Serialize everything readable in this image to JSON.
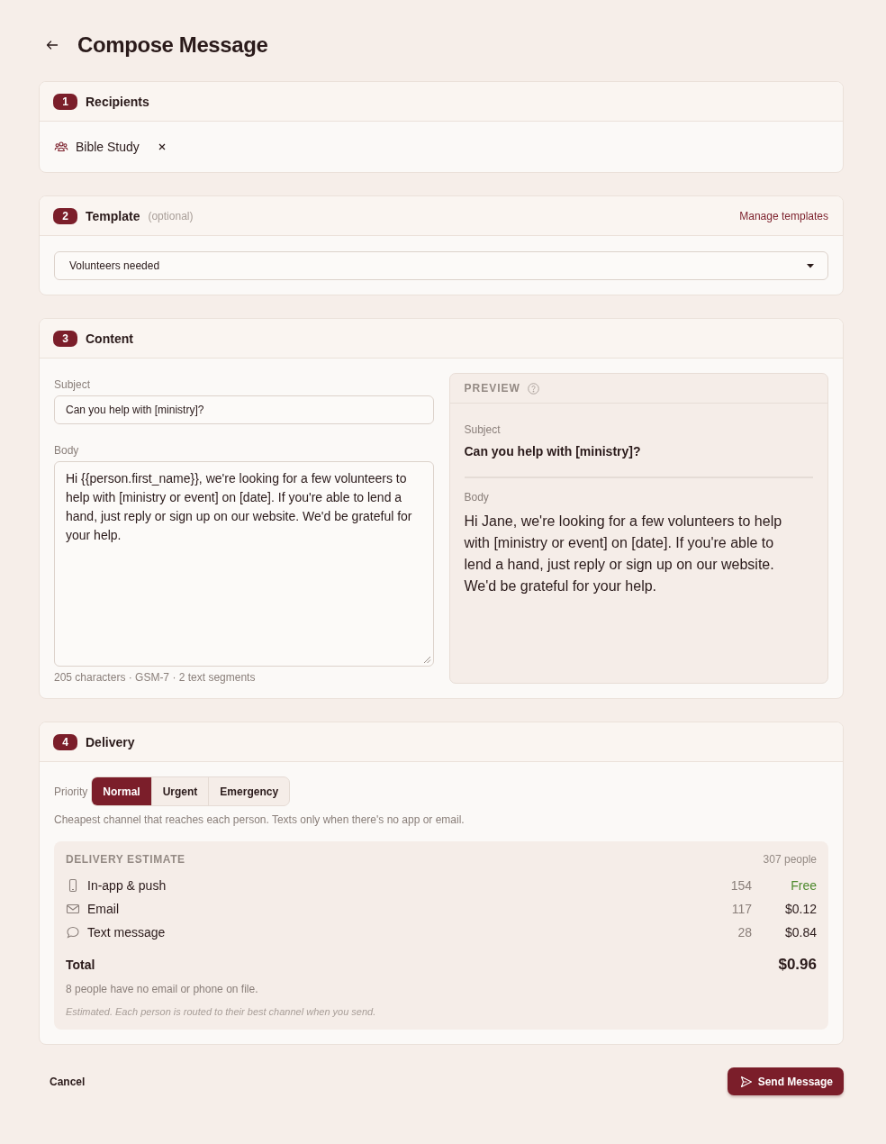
{
  "header": {
    "title": "Compose Message"
  },
  "recipients": {
    "step": "1",
    "title": "Recipients",
    "chips": [
      {
        "label": "Bible Study"
      }
    ]
  },
  "template": {
    "step": "2",
    "title": "Template",
    "hint": "(optional)",
    "link": "Manage templates",
    "select": {
      "value": "Volunteers needed"
    }
  },
  "content": {
    "step": "3",
    "title": "Content",
    "subject": {
      "label": "Subject",
      "value": "Can you help with [ministry]?"
    },
    "body": {
      "label": "Body",
      "value": "Hi {{person.first_name}}, we're looking for a few volunteers to help with [ministry or event] on [date]. If you're able to lend a hand, just reply or sign up on our website. We'd be grateful for your help."
    },
    "counter": "205 characters · GSM-7 · 2 text segments",
    "preview": {
      "title": "PREVIEW",
      "subject_label": "Subject",
      "subject": "Can you help with [ministry]?",
      "body_label": "Body",
      "body": "Hi Jane, we're looking for a few volunteers to help with [ministry or event] on [date]. If you're able to lend a hand, just reply or sign up on our website. We'd be grateful for your help."
    }
  },
  "delivery": {
    "step": "4",
    "title": "Delivery",
    "priority": {
      "label": "Priority",
      "options": [
        {
          "label": "Normal",
          "selected": true
        },
        {
          "label": "Urgent",
          "selected": false
        },
        {
          "label": "Emergency",
          "selected": false
        }
      ]
    },
    "description": "Cheapest channel that reaches each person. Texts only when there's no app or email.",
    "estimate": {
      "title": "DELIVERY ESTIMATE",
      "people": "307 people",
      "channels": [
        {
          "kind": "app",
          "name": "In-app & push",
          "count": "154",
          "cost": "Free",
          "free": true
        },
        {
          "kind": "email",
          "name": "Email",
          "count": "117",
          "cost": "$0.12",
          "free": false
        },
        {
          "kind": "sms",
          "name": "Text message",
          "count": "28",
          "cost": "$0.84",
          "free": false
        }
      ],
      "total_label": "Total",
      "total": "$0.96",
      "note": "8 people have no email or phone on file.",
      "disclaimer": "Estimated. Each person is routed to their best channel when you send."
    }
  },
  "footer": {
    "cancel": "Cancel",
    "send": "Send Message"
  }
}
